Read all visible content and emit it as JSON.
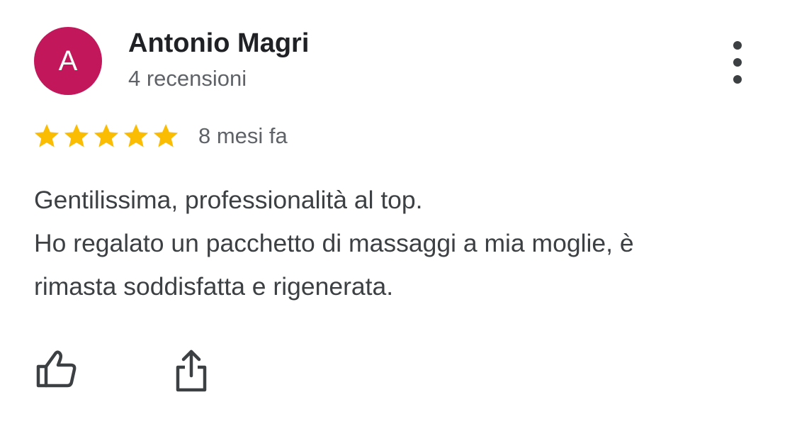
{
  "review": {
    "author": {
      "initial": "A",
      "name": "Antonio Magri",
      "review_count": "4 recensioni",
      "avatar_color": "#c2185b"
    },
    "rating": 5,
    "star_color": "#fbbc04",
    "date": "8 mesi fa",
    "text_lines": [
      "Gentilissima, professionalità al top.",
      "Ho regalato un pacchetto di massaggi a mia moglie, è",
      "rimasta soddisfatta e rigenerata."
    ]
  },
  "icons": {
    "menu": "more-vert-icon",
    "like": "thumbs-up-icon",
    "share": "share-icon",
    "star": "star-icon"
  }
}
